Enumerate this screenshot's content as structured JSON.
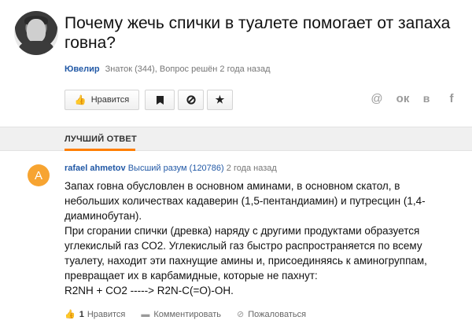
{
  "question": {
    "title": "Почему жечь спички в туалете помогает от запаха говна?",
    "author": "Ювелир",
    "info": "Знаток (344), Вопрос решён 2 года назад"
  },
  "buttons": {
    "like_label": "Нравится",
    "like_icon": "thumbs-up-icon",
    "bookmark_icon": "bookmark-icon",
    "block_icon": "block-icon",
    "star_icon": "star-icon"
  },
  "share": {
    "mail": "@",
    "ok": "ок",
    "vk": "в",
    "fb": "f"
  },
  "best_answer": {
    "label": "ЛУЧШИЙ ОТВЕТ"
  },
  "answer": {
    "avatar_letter": "A",
    "avatar_color": "#f7a431",
    "author": "rafael ahmetov",
    "rank": "Высший разум (120786)",
    "time": "2 года назад",
    "lines": [
      "Запах говна обусловлен в основном аминами, в основном скатол, в небольших количествах кадаверин (1,5-пентандиамин) и путресцин (1,4-диаминобутан).",
      "При сгорании спички (древка) наряду с другими продуктами образуется углекислый газ СО2. Углекислый газ быстро распространяется по всему туалету, находит эти пахнущие амины и, присоединяясь к аминогруппам, превращает их в карбамидные, которые не пахнут:",
      "R2NH + CO2 -----> R2N-C(=O)-OH."
    ],
    "likes_count": "1",
    "like_label": "Нравится",
    "comment_label": "Комментировать",
    "report_label": "Пожаловаться"
  },
  "colors": {
    "link": "#2259a6",
    "accent": "#ff7e00"
  }
}
